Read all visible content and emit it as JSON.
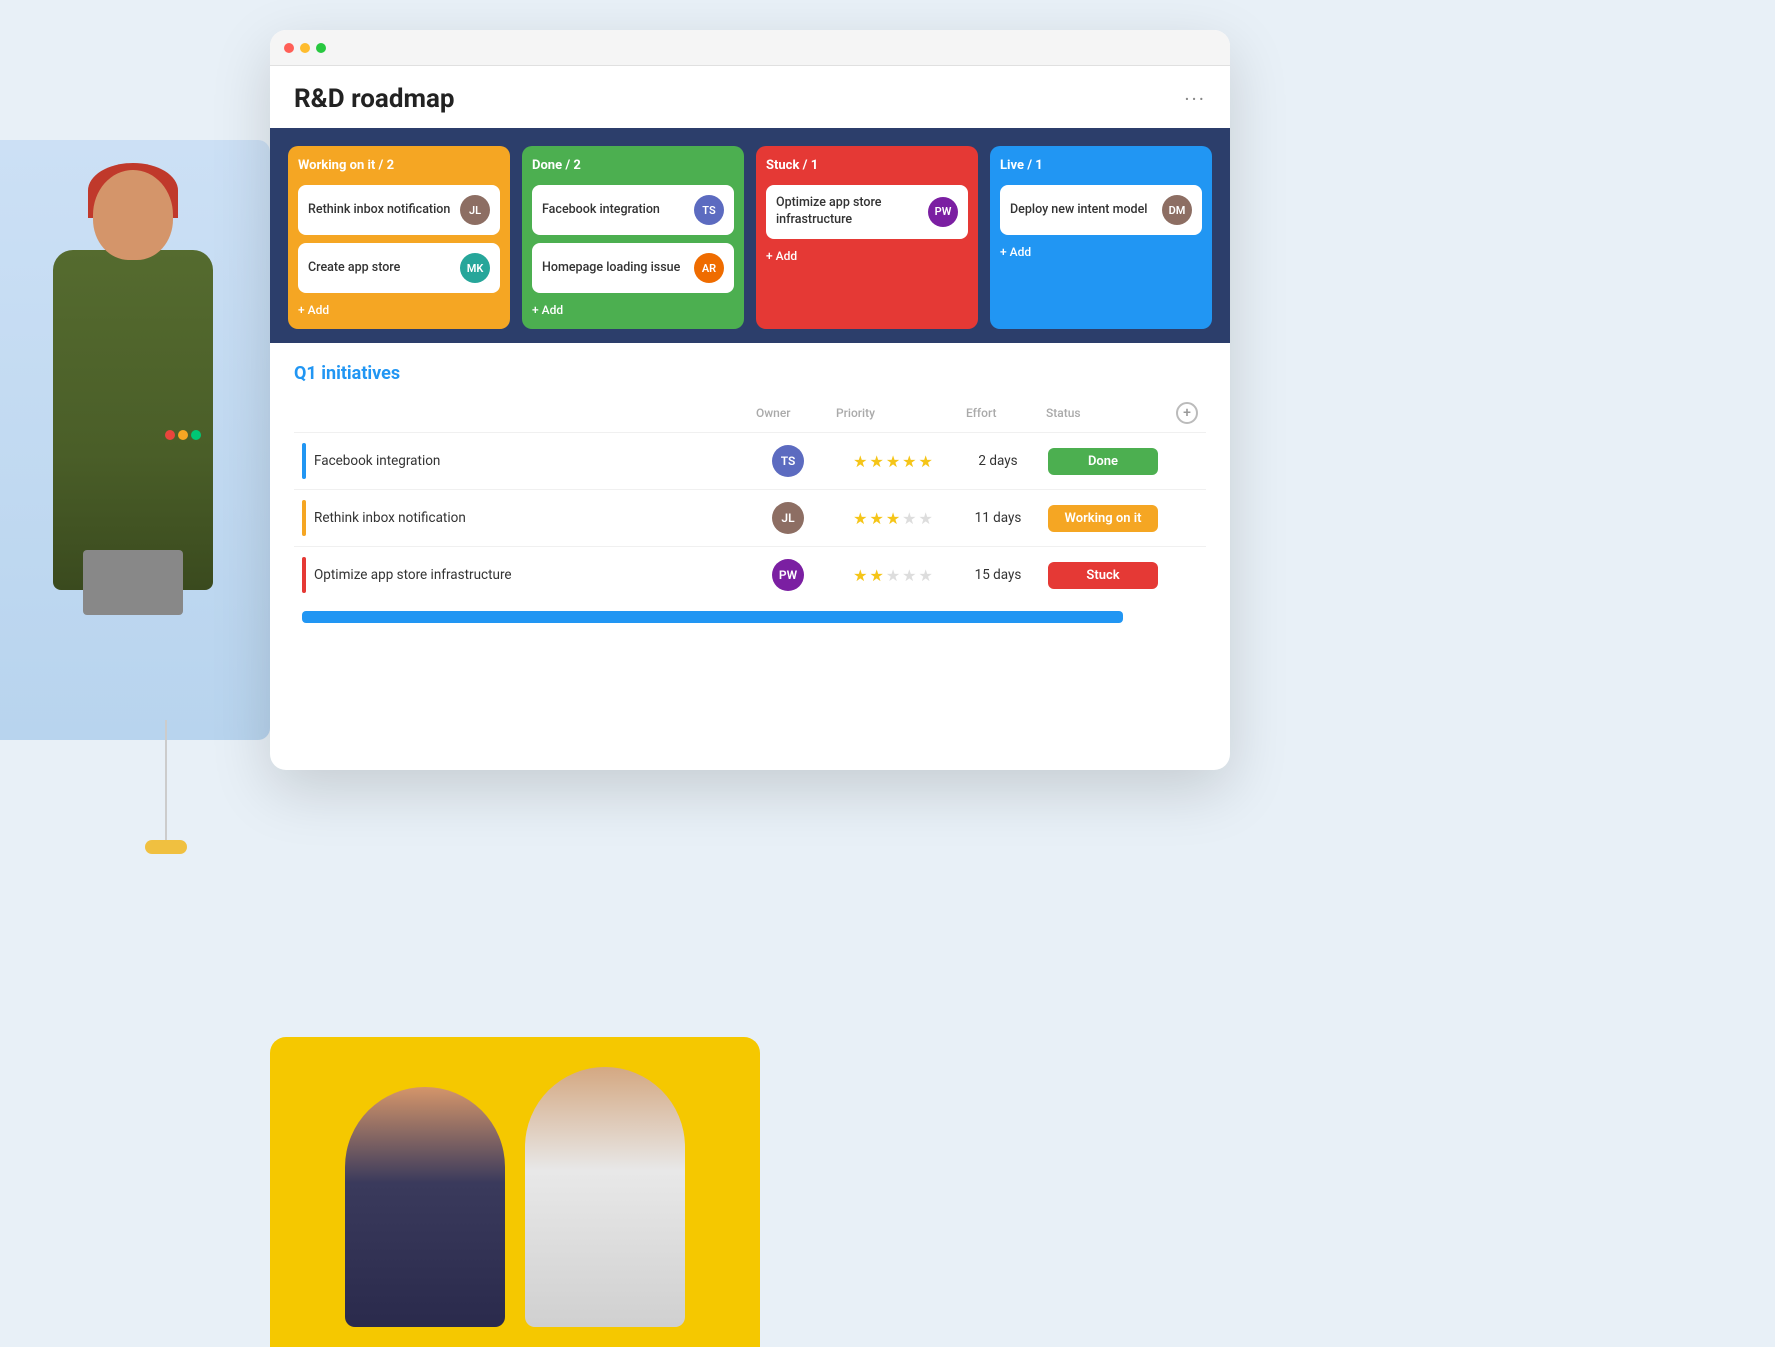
{
  "app": {
    "title": "R&D roadmap",
    "more_dots": "···"
  },
  "window": {
    "traffic_dots": [
      "red",
      "yellow",
      "green"
    ]
  },
  "kanban": {
    "columns": [
      {
        "id": "working",
        "title": "Working on it / 2",
        "color": "col-working",
        "cards": [
          {
            "text": "Rethink inbox notification",
            "avatar_class": "avatar-1",
            "avatar_initials": "JL"
          },
          {
            "text": "Create app store",
            "avatar_class": "avatar-3",
            "avatar_initials": "MK"
          }
        ],
        "add_label": "+ Add"
      },
      {
        "id": "done",
        "title": "Done / 2",
        "color": "col-done",
        "cards": [
          {
            "text": "Facebook integration",
            "avatar_class": "avatar-2",
            "avatar_initials": "TS"
          },
          {
            "text": "Homepage loading issue",
            "avatar_class": "avatar-4",
            "avatar_initials": "AR"
          }
        ],
        "add_label": "+ Add"
      },
      {
        "id": "stuck",
        "title": "Stuck / 1",
        "color": "col-stuck",
        "cards": [
          {
            "text": "Optimize app store infrastructure",
            "avatar_class": "avatar-5",
            "avatar_initials": "PW"
          }
        ],
        "add_label": "+ Add"
      },
      {
        "id": "live",
        "title": "Live / 1",
        "color": "col-live",
        "cards": [
          {
            "text": "Deploy new intent model",
            "avatar_class": "avatar-1",
            "avatar_initials": "DM"
          }
        ],
        "add_label": "+ Add"
      }
    ]
  },
  "list": {
    "title": "Q1 initiatives",
    "columns": {
      "owner": "Owner",
      "priority": "Priority",
      "effort": "Effort",
      "status": "Status"
    },
    "rows": [
      {
        "task": "Facebook integration",
        "indicator": "ind-blue",
        "avatar_class": "avatar-2",
        "avatar_initials": "TS",
        "stars_filled": 5,
        "stars_total": 5,
        "effort": "2 days",
        "status": "Done",
        "badge_class": "badge-done"
      },
      {
        "task": "Rethink inbox notification",
        "indicator": "ind-orange",
        "avatar_class": "avatar-1",
        "avatar_initials": "JL",
        "stars_filled": 3,
        "stars_total": 5,
        "effort": "11 days",
        "status": "Working on it",
        "badge_class": "badge-working"
      },
      {
        "task": "Optimize app store infrastructure",
        "indicator": "ind-red",
        "avatar_class": "avatar-5",
        "avatar_initials": "PW",
        "stars_filled": 2,
        "stars_total": 5,
        "effort": "15 days",
        "status": "Stuck",
        "badge_class": "badge-stuck"
      }
    ]
  },
  "logo": {
    "dots": [
      "#e8453c",
      "#f5a623",
      "#00c875"
    ]
  }
}
